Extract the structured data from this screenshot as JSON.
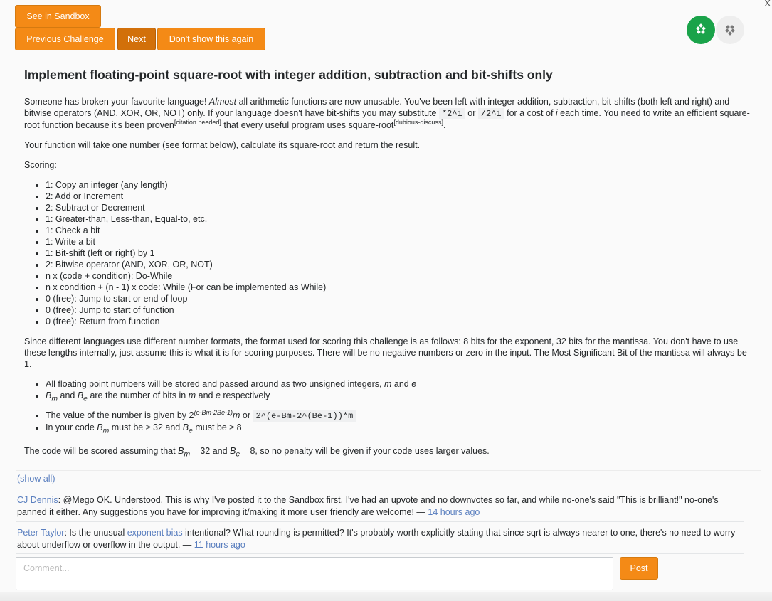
{
  "toolbar": {
    "see_in_sandbox": "See in Sandbox",
    "previous_challenge": "Previous Challenge",
    "next": "Next",
    "dont_show": "Don't show this again",
    "close": "X"
  },
  "icons": {
    "green_circle": "upvote-icon",
    "grey_circle": "downvote-icon"
  },
  "colors": {
    "button": "#f48a16",
    "button_active": "#d2700a",
    "upvote": "#1aa34a",
    "link": "#5a7fbf"
  },
  "post": {
    "title": "Implement floating-point square-root with integer addition, subtraction and bit-shifts only",
    "intro": {
      "a": "Someone has broken your favourite language! ",
      "almost": "Almost",
      "b": " all arithmetic functions are now unusable. You've been left with integer addition, subtraction, bit-shifts (both left and right) and bitwise operators (AND, XOR, OR, NOT) only. If your language doesn't have bit-shifts you may substitute ",
      "code1": "*2^i",
      "or": " or ",
      "code2": "/2^i",
      "c": " for a cost of ",
      "i": "i",
      "d": " each time. You need to write an efficient square-root function because it's been proven",
      "citation": "[citation needed]",
      "e": " that every useful program uses square-root",
      "dubious": "[dubious-discuss]",
      "f": "."
    },
    "function_desc": "Your function will take one number (see format below), calculate its square-root and return the result.",
    "scoring_label": "Scoring:",
    "scoring_items": [
      "1: Copy an integer (any length)",
      "2: Add or Increment",
      "2: Subtract or Decrement",
      "1: Greater-than, Less-than, Equal-to, etc.",
      "1: Check a bit",
      "1: Write a bit",
      "1: Bit-shift (left or right) by 1",
      "2: Bitwise operator (AND, XOR, OR, NOT)",
      "n x (code + condition): Do-While",
      "n x condition + (n - 1) x code: While (For can be implemented as While)",
      "0 (free): Jump to start or end of loop",
      "0 (free): Jump to start of function",
      "0 (free): Return from function"
    ],
    "format_para": "Since different languages use different number formats, the format used for scoring this challenge is as follows: 8 bits for the exponent, 32 bits for the mantissa. You don't have to use these lengths internally, just assume this is what it is for scoring purposes. There will be no negative numbers or zero in the input. The Most Significant Bit of the mantissa will always be 1.",
    "format_items": {
      "item1": {
        "text": "All floating point numbers will be stored and passed around as two unsigned integers, ",
        "m": "m",
        "and": " and ",
        "e": "e"
      },
      "item2": {
        "bm": "B",
        "bm_sub": "m",
        "and": " and ",
        "be": "B",
        "be_sub": "e",
        "rest": " are the number of bits in ",
        "m": "m",
        "and2": " and ",
        "e": "e",
        "rest2": " respectively"
      },
      "item3": {
        "text": "The value of the number is given by 2",
        "exp": "(e-Bm-2Be-1)",
        "m": "m",
        "or": " or ",
        "code": "2^(e-Bm-2^(Be-1))*m"
      },
      "item4": {
        "a": "In your code ",
        "b": " must be ≥ 32 and ",
        "c": " must be ≥ 8"
      }
    },
    "final_para": {
      "a": "The code will be scored assuming that ",
      "b": " = 32 and ",
      "c": " = 8, so no penalty will be given if your code uses larger values."
    }
  },
  "show_all": "(show all)",
  "comments": [
    {
      "user": "CJ Dennis",
      "text": ": @Mego OK. Understood. This is why I've posted it to the Sandbox first. I've had an upvote and no downvotes so far, and while no-one's said \"This is brilliant!\" no-one's panned it either. Any suggestions you have for improving it/making it more user friendly are welcome! — ",
      "time": "14 hours ago"
    },
    {
      "user": "Peter Taylor",
      "text_a": ": Is the unusual ",
      "link": "exponent bias",
      "text_b": " intentional? What rounding is permitted? It's probably worth explicitly stating that since sqrt is always nearer to one, there's no need to worry about underflow or overflow in the output. — ",
      "time": "11 hours ago"
    }
  ],
  "comment_form": {
    "placeholder": "Comment...",
    "value": "",
    "post_label": "Post"
  }
}
